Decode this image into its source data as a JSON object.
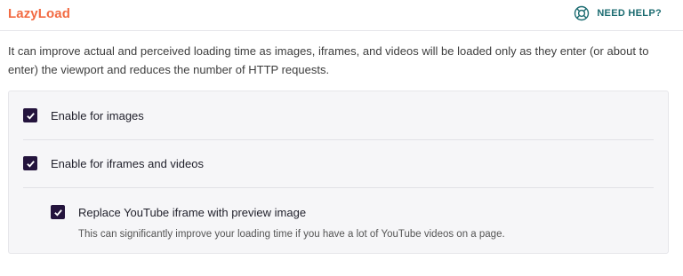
{
  "header": {
    "title": "LazyLoad",
    "help_label": "NEED HELP?",
    "help_icon": "lifebuoy-icon"
  },
  "description": "It can improve actual and perceived loading time as images, iframes, and videos will be loaded only as they enter (or about to enter) the viewport and reduces the number of HTTP requests.",
  "options": [
    {
      "label": "Enable for images",
      "checked": true
    },
    {
      "label": "Enable for iframes and videos",
      "checked": true
    },
    {
      "label": "Replace YouTube iframe with preview image",
      "checked": true,
      "description": "This can significantly improve your loading time if you have a lot of YouTube videos on a page."
    }
  ],
  "colors": {
    "title": "#f26b43",
    "help": "#1b6b70",
    "checkbox": "#24143d",
    "panel_bg": "#f6f6f8"
  }
}
